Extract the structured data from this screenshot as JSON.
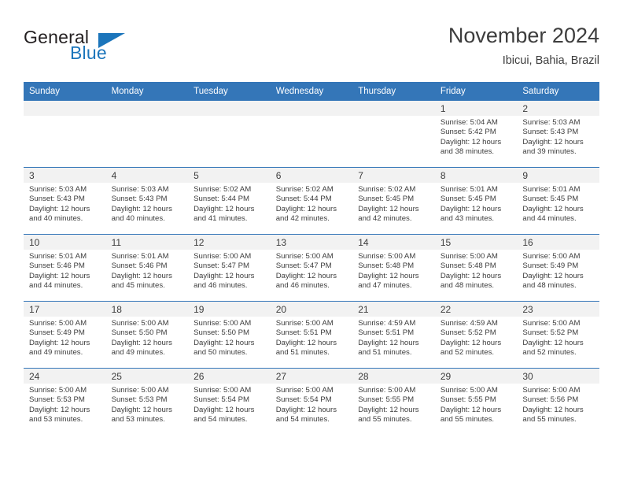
{
  "brand": {
    "name_part1": "General",
    "name_part2": "Blue",
    "triangle_icon": "triangle-icon",
    "accent_color": "#1b75bb"
  },
  "header": {
    "title": "November 2024",
    "subtitle": "Ibicui, Bahia, Brazil"
  },
  "theme": {
    "header_blue": "#3476b8",
    "daynum_band": "#f2f2f2",
    "text": "#3d3d3d"
  },
  "weekday_headers": [
    "Sunday",
    "Monday",
    "Tuesday",
    "Wednesday",
    "Thursday",
    "Friday",
    "Saturday"
  ],
  "weeks": [
    [
      {
        "day": "",
        "empty": true
      },
      {
        "day": "",
        "empty": true
      },
      {
        "day": "",
        "empty": true
      },
      {
        "day": "",
        "empty": true
      },
      {
        "day": "",
        "empty": true
      },
      {
        "day": "1",
        "sunrise": "Sunrise: 5:04 AM",
        "sunset": "Sunset: 5:42 PM",
        "daylight1": "Daylight: 12 hours",
        "daylight2": "and 38 minutes."
      },
      {
        "day": "2",
        "sunrise": "Sunrise: 5:03 AM",
        "sunset": "Sunset: 5:43 PM",
        "daylight1": "Daylight: 12 hours",
        "daylight2": "and 39 minutes."
      }
    ],
    [
      {
        "day": "3",
        "sunrise": "Sunrise: 5:03 AM",
        "sunset": "Sunset: 5:43 PM",
        "daylight1": "Daylight: 12 hours",
        "daylight2": "and 40 minutes."
      },
      {
        "day": "4",
        "sunrise": "Sunrise: 5:03 AM",
        "sunset": "Sunset: 5:43 PM",
        "daylight1": "Daylight: 12 hours",
        "daylight2": "and 40 minutes."
      },
      {
        "day": "5",
        "sunrise": "Sunrise: 5:02 AM",
        "sunset": "Sunset: 5:44 PM",
        "daylight1": "Daylight: 12 hours",
        "daylight2": "and 41 minutes."
      },
      {
        "day": "6",
        "sunrise": "Sunrise: 5:02 AM",
        "sunset": "Sunset: 5:44 PM",
        "daylight1": "Daylight: 12 hours",
        "daylight2": "and 42 minutes."
      },
      {
        "day": "7",
        "sunrise": "Sunrise: 5:02 AM",
        "sunset": "Sunset: 5:45 PM",
        "daylight1": "Daylight: 12 hours",
        "daylight2": "and 42 minutes."
      },
      {
        "day": "8",
        "sunrise": "Sunrise: 5:01 AM",
        "sunset": "Sunset: 5:45 PM",
        "daylight1": "Daylight: 12 hours",
        "daylight2": "and 43 minutes."
      },
      {
        "day": "9",
        "sunrise": "Sunrise: 5:01 AM",
        "sunset": "Sunset: 5:45 PM",
        "daylight1": "Daylight: 12 hours",
        "daylight2": "and 44 minutes."
      }
    ],
    [
      {
        "day": "10",
        "sunrise": "Sunrise: 5:01 AM",
        "sunset": "Sunset: 5:46 PM",
        "daylight1": "Daylight: 12 hours",
        "daylight2": "and 44 minutes."
      },
      {
        "day": "11",
        "sunrise": "Sunrise: 5:01 AM",
        "sunset": "Sunset: 5:46 PM",
        "daylight1": "Daylight: 12 hours",
        "daylight2": "and 45 minutes."
      },
      {
        "day": "12",
        "sunrise": "Sunrise: 5:00 AM",
        "sunset": "Sunset: 5:47 PM",
        "daylight1": "Daylight: 12 hours",
        "daylight2": "and 46 minutes."
      },
      {
        "day": "13",
        "sunrise": "Sunrise: 5:00 AM",
        "sunset": "Sunset: 5:47 PM",
        "daylight1": "Daylight: 12 hours",
        "daylight2": "and 46 minutes."
      },
      {
        "day": "14",
        "sunrise": "Sunrise: 5:00 AM",
        "sunset": "Sunset: 5:48 PM",
        "daylight1": "Daylight: 12 hours",
        "daylight2": "and 47 minutes."
      },
      {
        "day": "15",
        "sunrise": "Sunrise: 5:00 AM",
        "sunset": "Sunset: 5:48 PM",
        "daylight1": "Daylight: 12 hours",
        "daylight2": "and 48 minutes."
      },
      {
        "day": "16",
        "sunrise": "Sunrise: 5:00 AM",
        "sunset": "Sunset: 5:49 PM",
        "daylight1": "Daylight: 12 hours",
        "daylight2": "and 48 minutes."
      }
    ],
    [
      {
        "day": "17",
        "sunrise": "Sunrise: 5:00 AM",
        "sunset": "Sunset: 5:49 PM",
        "daylight1": "Daylight: 12 hours",
        "daylight2": "and 49 minutes."
      },
      {
        "day": "18",
        "sunrise": "Sunrise: 5:00 AM",
        "sunset": "Sunset: 5:50 PM",
        "daylight1": "Daylight: 12 hours",
        "daylight2": "and 49 minutes."
      },
      {
        "day": "19",
        "sunrise": "Sunrise: 5:00 AM",
        "sunset": "Sunset: 5:50 PM",
        "daylight1": "Daylight: 12 hours",
        "daylight2": "and 50 minutes."
      },
      {
        "day": "20",
        "sunrise": "Sunrise: 5:00 AM",
        "sunset": "Sunset: 5:51 PM",
        "daylight1": "Daylight: 12 hours",
        "daylight2": "and 51 minutes."
      },
      {
        "day": "21",
        "sunrise": "Sunrise: 4:59 AM",
        "sunset": "Sunset: 5:51 PM",
        "daylight1": "Daylight: 12 hours",
        "daylight2": "and 51 minutes."
      },
      {
        "day": "22",
        "sunrise": "Sunrise: 4:59 AM",
        "sunset": "Sunset: 5:52 PM",
        "daylight1": "Daylight: 12 hours",
        "daylight2": "and 52 minutes."
      },
      {
        "day": "23",
        "sunrise": "Sunrise: 5:00 AM",
        "sunset": "Sunset: 5:52 PM",
        "daylight1": "Daylight: 12 hours",
        "daylight2": "and 52 minutes."
      }
    ],
    [
      {
        "day": "24",
        "sunrise": "Sunrise: 5:00 AM",
        "sunset": "Sunset: 5:53 PM",
        "daylight1": "Daylight: 12 hours",
        "daylight2": "and 53 minutes."
      },
      {
        "day": "25",
        "sunrise": "Sunrise: 5:00 AM",
        "sunset": "Sunset: 5:53 PM",
        "daylight1": "Daylight: 12 hours",
        "daylight2": "and 53 minutes."
      },
      {
        "day": "26",
        "sunrise": "Sunrise: 5:00 AM",
        "sunset": "Sunset: 5:54 PM",
        "daylight1": "Daylight: 12 hours",
        "daylight2": "and 54 minutes."
      },
      {
        "day": "27",
        "sunrise": "Sunrise: 5:00 AM",
        "sunset": "Sunset: 5:54 PM",
        "daylight1": "Daylight: 12 hours",
        "daylight2": "and 54 minutes."
      },
      {
        "day": "28",
        "sunrise": "Sunrise: 5:00 AM",
        "sunset": "Sunset: 5:55 PM",
        "daylight1": "Daylight: 12 hours",
        "daylight2": "and 55 minutes."
      },
      {
        "day": "29",
        "sunrise": "Sunrise: 5:00 AM",
        "sunset": "Sunset: 5:55 PM",
        "daylight1": "Daylight: 12 hours",
        "daylight2": "and 55 minutes."
      },
      {
        "day": "30",
        "sunrise": "Sunrise: 5:00 AM",
        "sunset": "Sunset: 5:56 PM",
        "daylight1": "Daylight: 12 hours",
        "daylight2": "and 55 minutes."
      }
    ]
  ]
}
